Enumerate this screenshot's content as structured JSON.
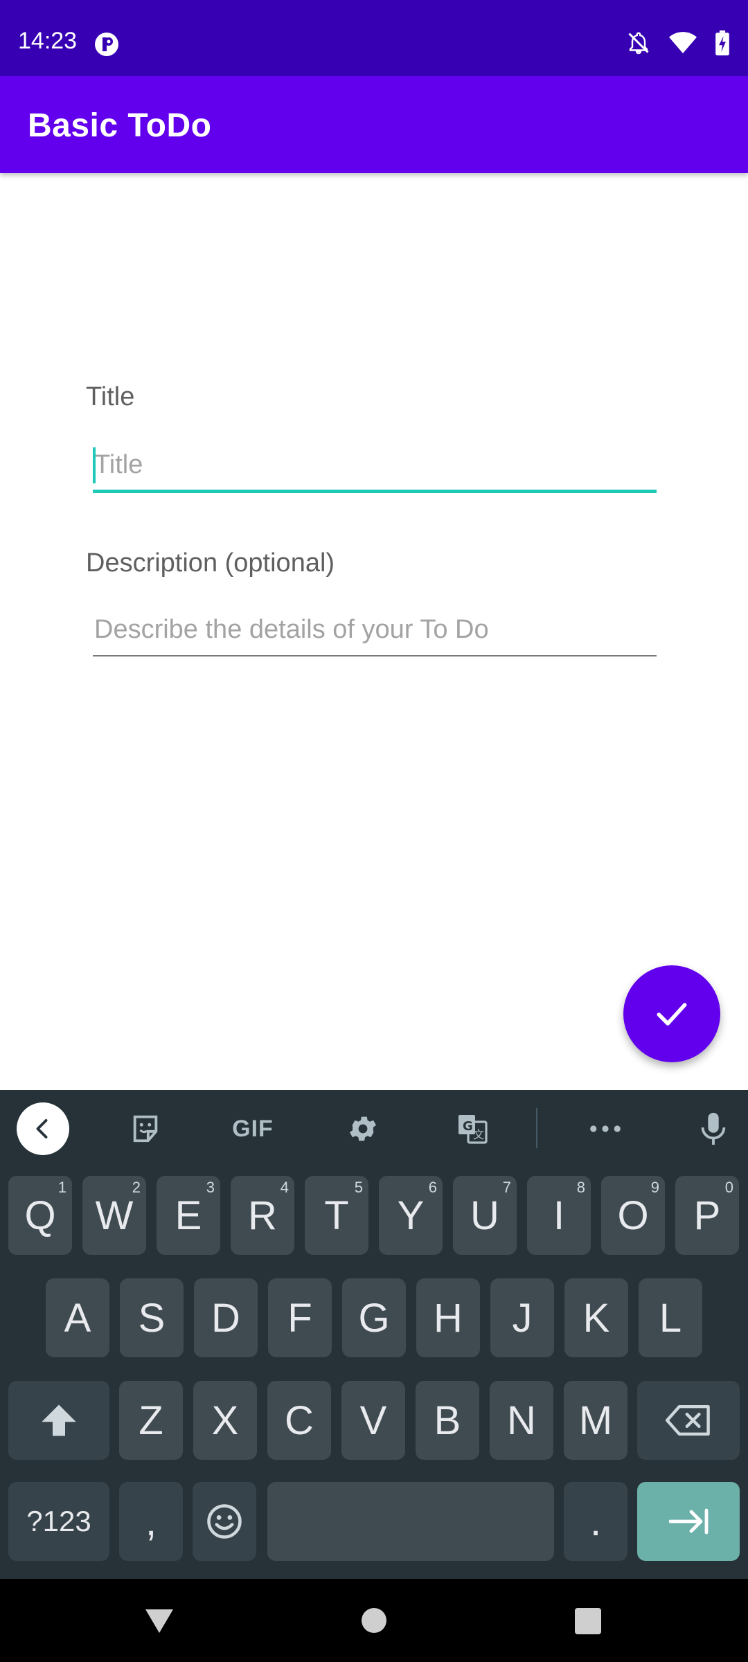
{
  "status_bar": {
    "time": "14:23"
  },
  "app_bar": {
    "title": "Basic ToDo"
  },
  "form": {
    "title_label": "Title",
    "title_placeholder": "Title",
    "description_label": "Description (optional)",
    "description_placeholder": "Describe the details of your To Do"
  },
  "fab": {
    "icon": "check-icon"
  },
  "keyboard": {
    "toolbar": {
      "gif_label": "GIF"
    },
    "rows": [
      [
        {
          "k": "Q",
          "h": "1"
        },
        {
          "k": "W",
          "h": "2"
        },
        {
          "k": "E",
          "h": "3"
        },
        {
          "k": "R",
          "h": "4"
        },
        {
          "k": "T",
          "h": "5"
        },
        {
          "k": "Y",
          "h": "6"
        },
        {
          "k": "U",
          "h": "7"
        },
        {
          "k": "I",
          "h": "8"
        },
        {
          "k": "O",
          "h": "9"
        },
        {
          "k": "P",
          "h": "0"
        }
      ],
      [
        {
          "k": "A"
        },
        {
          "k": "S"
        },
        {
          "k": "D"
        },
        {
          "k": "F"
        },
        {
          "k": "G"
        },
        {
          "k": "H"
        },
        {
          "k": "J"
        },
        {
          "k": "K"
        },
        {
          "k": "L"
        }
      ],
      [
        {
          "k": "Z"
        },
        {
          "k": "X"
        },
        {
          "k": "C"
        },
        {
          "k": "V"
        },
        {
          "k": "B"
        },
        {
          "k": "N"
        },
        {
          "k": "M"
        }
      ]
    ],
    "symbols_label": "?123",
    "comma_label": ",",
    "period_label": "."
  },
  "colors": {
    "primary": "#6200ee",
    "primary_dark": "#3700b3",
    "accent": "#1fc9b8",
    "keyboard_bg": "#263238"
  }
}
